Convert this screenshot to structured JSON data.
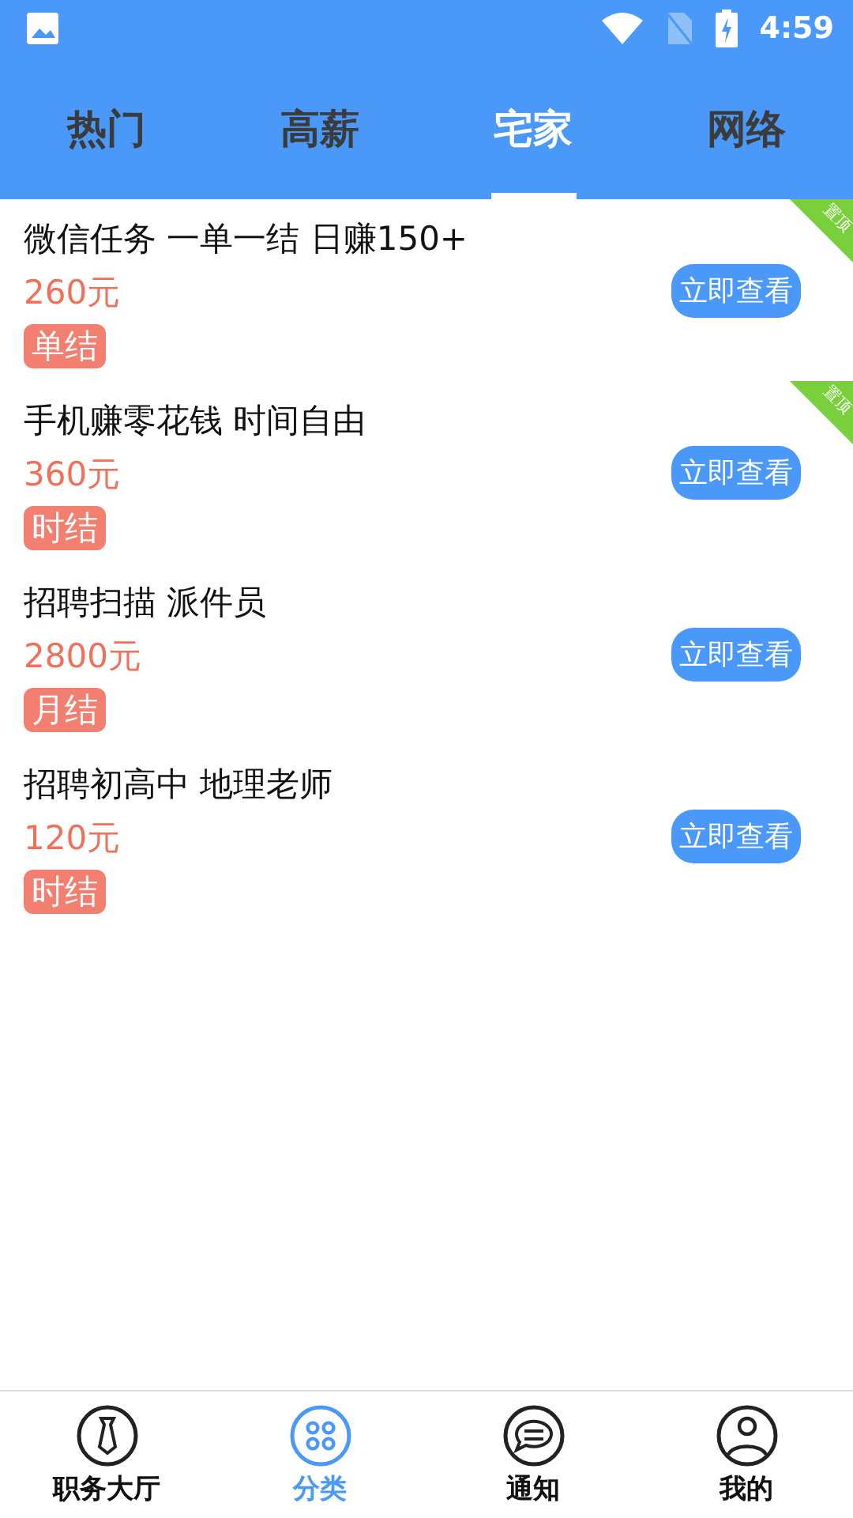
{
  "status_bar": {
    "time": "4:59"
  },
  "tabs": [
    {
      "label": "热门",
      "selected": false
    },
    {
      "label": "高薪",
      "selected": false
    },
    {
      "label": "宅家",
      "selected": true
    },
    {
      "label": "网络",
      "selected": false
    }
  ],
  "jobs": [
    {
      "title": "微信任务 一单一结 日赚150+",
      "pay": "260元",
      "tag": "单结",
      "button": "立即查看",
      "pinned": true,
      "ribbon": "置顶"
    },
    {
      "title": "手机赚零花钱 时间自由",
      "pay": "360元",
      "tag": "时结",
      "button": "立即查看",
      "pinned": true,
      "ribbon": "置顶"
    },
    {
      "title": "招聘扫描 派件员",
      "pay": "2800元",
      "tag": "月结",
      "button": "立即查看",
      "pinned": false
    },
    {
      "title": "招聘初高中 地理老师",
      "pay": "120元",
      "tag": "时结",
      "button": "立即查看",
      "pinned": false
    }
  ],
  "bottom_nav": [
    {
      "label": "职务大厅",
      "kind": "tie",
      "selected": false
    },
    {
      "label": "分类",
      "kind": "grid",
      "selected": true
    },
    {
      "label": "通知",
      "kind": "chat",
      "selected": false
    },
    {
      "label": "我的",
      "kind": "user",
      "selected": false
    }
  ]
}
